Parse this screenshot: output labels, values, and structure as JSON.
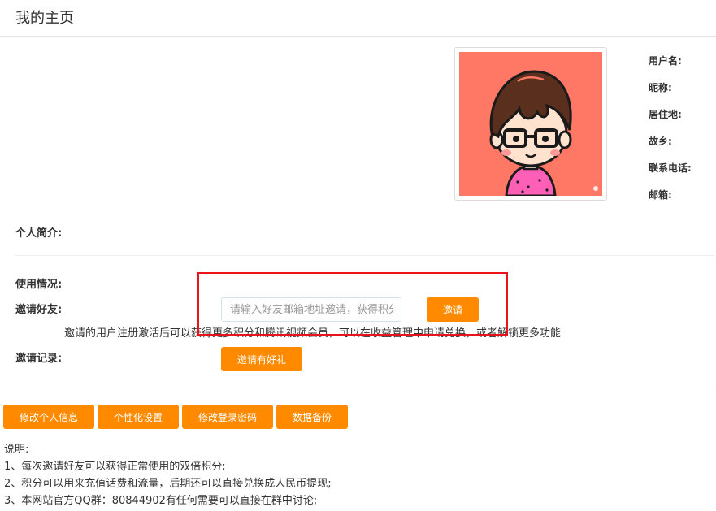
{
  "header": {
    "title": "我的主页"
  },
  "profile": {
    "labels": [
      "用户名:",
      "昵称:",
      "居住地:",
      "故乡:",
      "联系电话:",
      "邮箱:"
    ],
    "bio_label": "个人简介:"
  },
  "usage": {
    "usage_label": "使用情况:",
    "invite_label": "邀请好友:",
    "invite_placeholder": "请输入好友邮箱地址邀请，获得积分",
    "invite_button": "邀请",
    "invite_note": "邀请的用户注册激活后可以获得更多积分和腾讯视频会员，可以在收益管理中申请兑换，或者解锁更多功能",
    "records_label": "邀请记录:",
    "records_button": "邀请有好礼"
  },
  "actions": {
    "buttons": [
      "修改个人信息",
      "个性化设置",
      "修改登录密码",
      "数据备份"
    ]
  },
  "notes": {
    "title": "说明:",
    "items": [
      "1、每次邀请好友可以获得正常使用的双倍积分;",
      "2、积分可以用来充值话费和流量，后期还可以直接兑换成人民币提现;",
      "3、本网站官方QQ群：80844902有任何需要可以直接在群中讨论;"
    ]
  },
  "colors": {
    "accent": "#ff8a00",
    "highlight": "#e8141a",
    "avatar_background": "#ff7765"
  }
}
